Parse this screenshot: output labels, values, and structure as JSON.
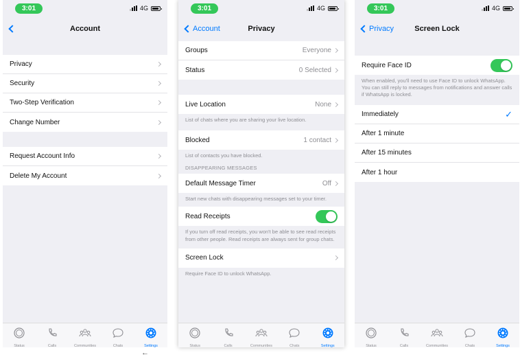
{
  "status": {
    "time": "3:01",
    "network": "4G"
  },
  "screen1": {
    "nav": {
      "title": "Account"
    },
    "group1": [
      {
        "label": "Privacy"
      },
      {
        "label": "Security"
      },
      {
        "label": "Two-Step Verification"
      },
      {
        "label": "Change Number"
      }
    ],
    "group2": [
      {
        "label": "Request Account Info"
      },
      {
        "label": "Delete My Account"
      }
    ]
  },
  "screen2": {
    "nav": {
      "back": "Account",
      "title": "Privacy"
    },
    "groups": {
      "label": "Groups",
      "value": "Everyone"
    },
    "status": {
      "label": "Status",
      "value": "0 Selected"
    },
    "live_location": {
      "label": "Live Location",
      "value": "None",
      "note": "List of chats where you are sharing your live location."
    },
    "blocked": {
      "label": "Blocked",
      "value": "1 contact",
      "note": "List of contacts you have blocked."
    },
    "disappearing_header": "DISAPPEARING MESSAGES",
    "default_timer": {
      "label": "Default Message Timer",
      "value": "Off",
      "note": "Start new chats with disappearing messages set to your timer."
    },
    "read_receipts": {
      "label": "Read Receipts",
      "on": true,
      "note": "If you turn off read receipts, you won't be able to see read receipts from other people. Read receipts are always sent for group chats."
    },
    "screen_lock": {
      "label": "Screen Lock",
      "note": "Require Face ID to unlock WhatsApp."
    }
  },
  "screen3": {
    "nav": {
      "back": "Privacy",
      "title": "Screen Lock"
    },
    "require_face_id": {
      "label": "Require Face ID",
      "on": true
    },
    "note": "When enabled, you'll need to use Face ID to unlock WhatsApp. You can still reply to messages from notifications and answer calls if WhatsApp is locked.",
    "options": [
      {
        "label": "Immediately",
        "selected": true
      },
      {
        "label": "After 1 minute",
        "selected": false
      },
      {
        "label": "After 15 minutes",
        "selected": false
      },
      {
        "label": "After 1 hour",
        "selected": false
      }
    ]
  },
  "tabs": [
    {
      "label": "Status",
      "icon": "status-icon"
    },
    {
      "label": "Calls",
      "icon": "phone-icon"
    },
    {
      "label": "Communities",
      "icon": "communities-icon"
    },
    {
      "label": "Chats",
      "icon": "chat-bubble-icon"
    },
    {
      "label": "Settings",
      "icon": "settings-gear-icon",
      "active": true
    }
  ],
  "colors": {
    "accent": "#007aff",
    "toggle_on": "#34c759",
    "time_pill": "#34c759"
  }
}
